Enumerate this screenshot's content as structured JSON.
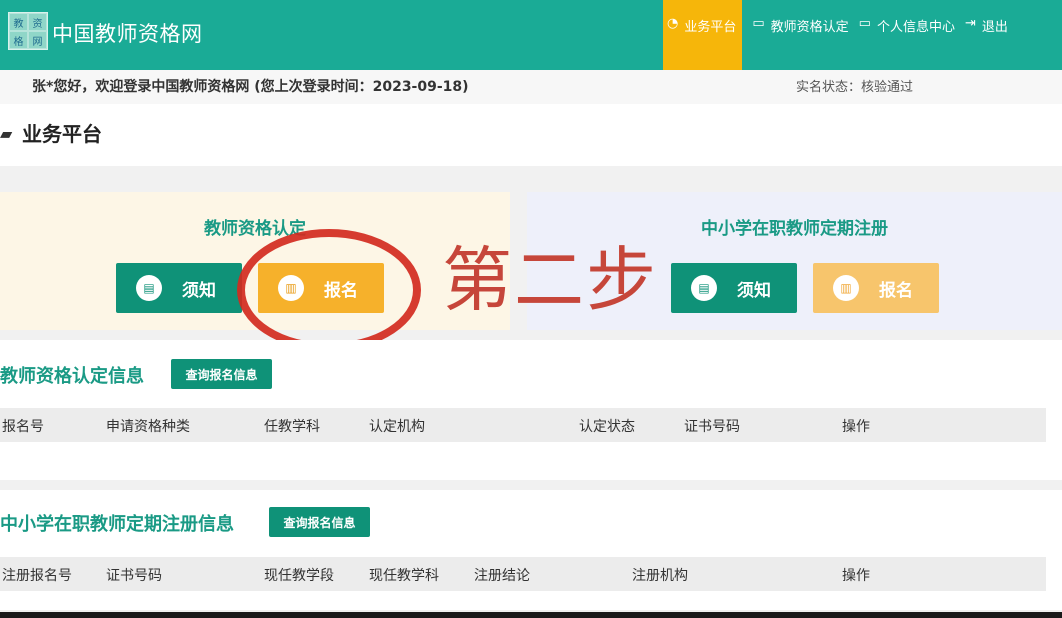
{
  "header": {
    "logo_chars": [
      "教",
      "资",
      "格",
      "网"
    ],
    "site_title": "中国教师资格网",
    "nav": [
      {
        "label": "业务平台",
        "icon": "dashboard-icon"
      },
      {
        "label": "教师资格认定",
        "icon": "monitor-icon"
      },
      {
        "label": "个人信息中心",
        "icon": "laptop-icon"
      },
      {
        "label": "退出",
        "icon": "logout-icon"
      }
    ],
    "active_color": "#f6b60a",
    "bg_color": "#1aab96"
  },
  "welcome": {
    "text": "张*您好，欢迎登录中国教师资格网 (您上次登录时间：2023-09-18)",
    "status": "实名状态：核验通过"
  },
  "page": {
    "title": "业务平台"
  },
  "panels": {
    "left": {
      "title": "教师资格认定",
      "notice_label": "须知",
      "signup_label": "报名"
    },
    "right": {
      "title": "中小学在职教师定期注册",
      "notice_label": "须知",
      "signup_label": "报名"
    }
  },
  "annotation": {
    "text": "第二步",
    "color": "#d22a20"
  },
  "section1": {
    "title": "教师资格认定信息",
    "query_label": "查询报名信息",
    "columns": [
      "报名号",
      "申请资格种类",
      "任教学科",
      "认定机构",
      "认定状态",
      "证书号码",
      "操作"
    ]
  },
  "section2": {
    "title": "中小学在职教师定期注册信息",
    "query_label": "查询报名信息",
    "columns": [
      "注册报名号",
      "证书号码",
      "现任教学段",
      "现任教学科",
      "注册结论",
      "注册机构",
      "操作"
    ]
  }
}
